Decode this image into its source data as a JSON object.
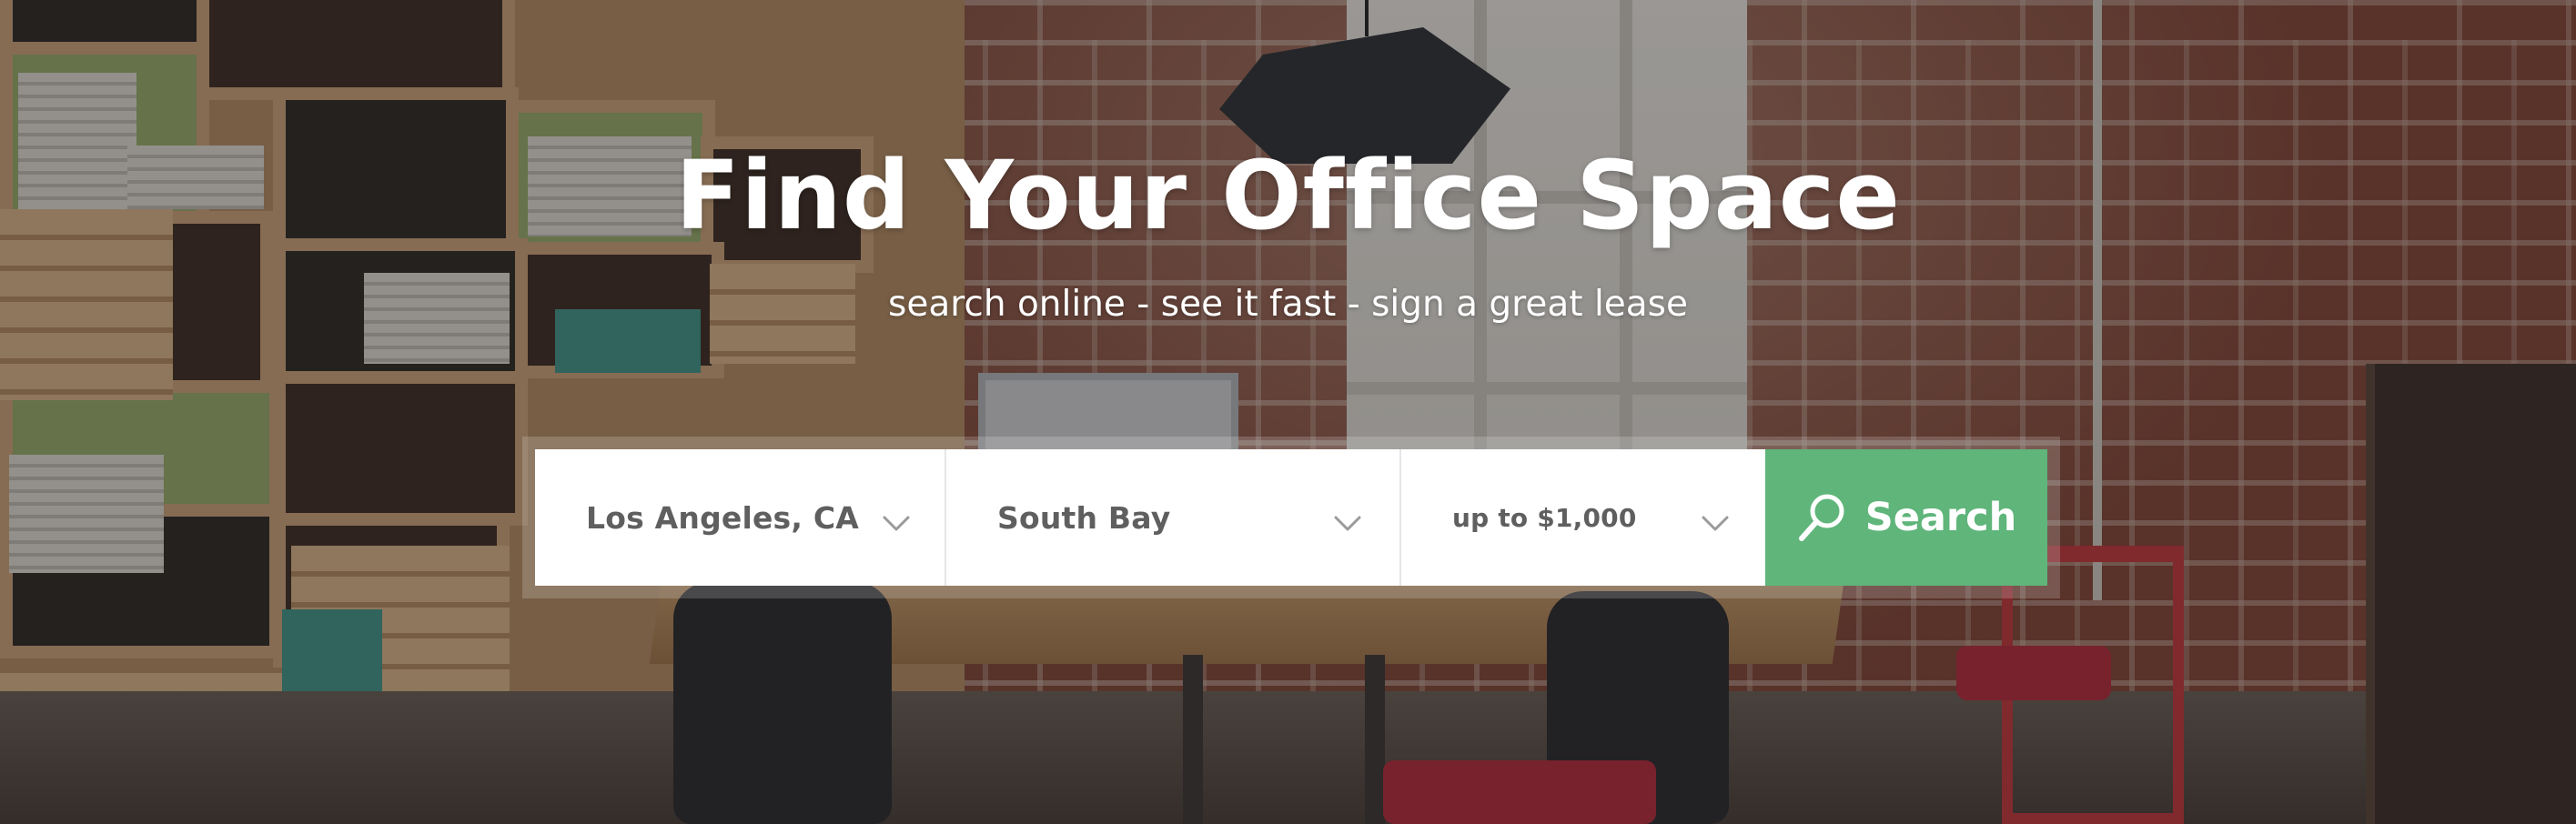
{
  "hero": {
    "title": "Find Your Office Space",
    "tagline": "search online - see it fast - sign a great lease"
  },
  "search": {
    "city": {
      "value": "Los Angeles, CA",
      "icon": "chevron-down-icon"
    },
    "area": {
      "value": "South Bay",
      "icon": "chevron-down-icon"
    },
    "price": {
      "value": "up to $1,000",
      "icon": "chevron-down-icon"
    },
    "button": {
      "label": "Search",
      "icon": "search-icon"
    }
  },
  "colors": {
    "accent": "#5fb57a",
    "field_text": "#5f5f5f",
    "field_bg": "#ffffff",
    "heading_text": "#ffffff"
  }
}
